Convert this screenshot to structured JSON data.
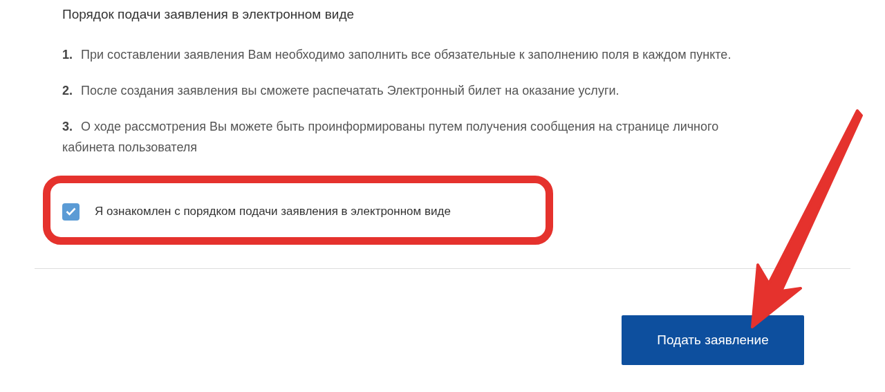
{
  "title": "Порядок подачи заявления в электронном виде",
  "steps": [
    {
      "number": "1.",
      "text": "При составлении заявления Вам необходимо заполнить все обязательные к заполнению поля в каждом пункте."
    },
    {
      "number": "2.",
      "text": "После создания заявления вы сможете распечатать Электронный билет на оказание услуги."
    },
    {
      "number": "3.",
      "text": "О ходе рассмотрения Вы можете быть проинформированы путем получения сообщения на странице личного кабинета пользователя"
    }
  ],
  "agreement": {
    "label": "Я ознакомлен с порядком подачи заявления в электронном виде",
    "checked": true
  },
  "submit_button": {
    "label": "Подать заявление"
  }
}
